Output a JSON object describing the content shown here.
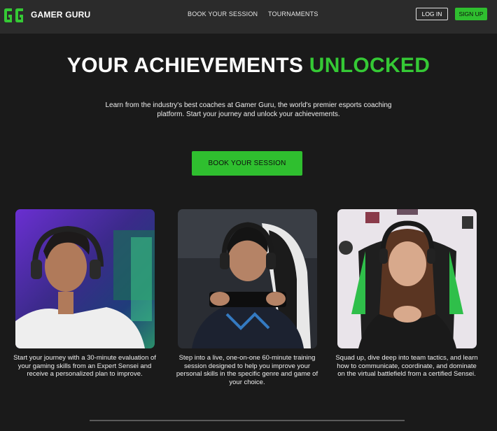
{
  "nav": {
    "brand": "GAMER GURU",
    "links": [
      "BOOK YOUR SESSION",
      "TOURNAMENTS"
    ],
    "login": "LOG IN",
    "signup": "SIGN UP"
  },
  "hero": {
    "title_main": "YOUR ACHIEVEMENTS",
    "title_accent": "UNLOCKED",
    "description": "Learn from the industry's best coaches at Gamer Guru, the world's premier esports coaching platform. Start your journey and unlock your achievements.",
    "cta": "BOOK YOUR SESSION"
  },
  "cards": [
    {
      "text": "Start your journey with a 30-minute evaluation of your gaming skills from an Expert Sensei and receive a personalized plan to improve."
    },
    {
      "text": "Step into a live, one-on-one 60-minute training session designed to help you improve your personal skills in the specific genre and game of your choice."
    },
    {
      "text": "Squad up, dive deep into team tactics, and learn how to communicate, coordinate, and dominate on the virtual battlefield from a certified Sensei."
    }
  ],
  "colors": {
    "accent": "#2fbf2f",
    "background": "#1a1a1a",
    "navbar": "#2b2b2b"
  },
  "icons": {
    "logo": "gg-logo-icon"
  }
}
